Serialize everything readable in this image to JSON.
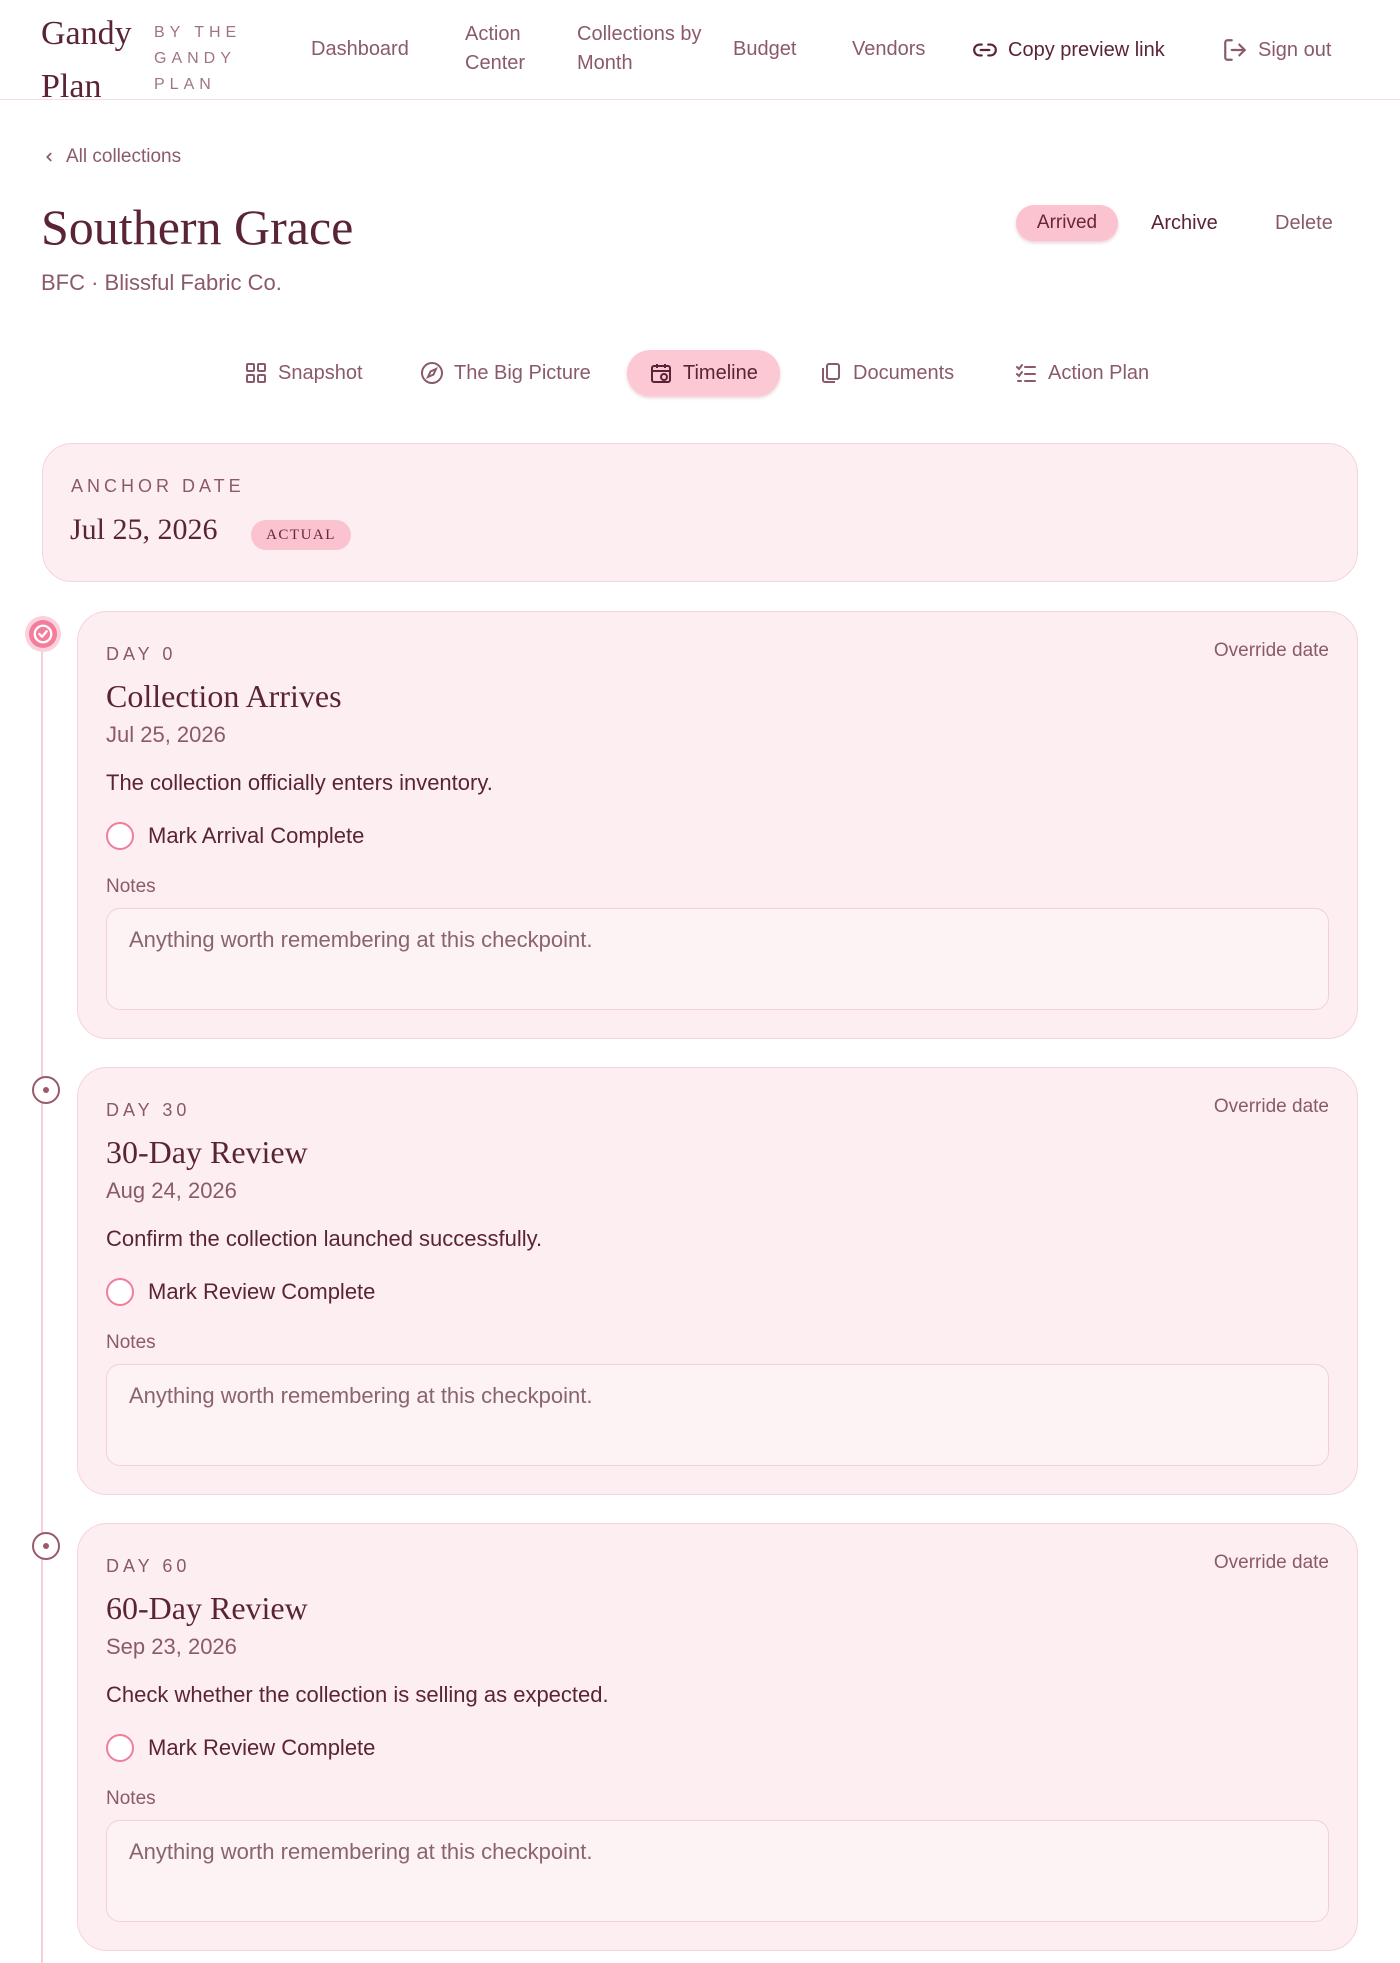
{
  "header": {
    "logo_line1": "Gandy",
    "logo_line2": "Plan",
    "logo_sub1": "BY THE",
    "logo_sub2": "GANDY",
    "logo_sub3": "PLAN",
    "nav": [
      {
        "label": "Dashboard"
      },
      {
        "label": "Action Center"
      },
      {
        "label": "Collections by Month"
      },
      {
        "label": "Budget"
      },
      {
        "label": "Vendors"
      }
    ],
    "copy_link": "Copy preview link",
    "sign_out": "Sign out"
  },
  "breadcrumb": "All collections",
  "collection": {
    "title": "Southern Grace",
    "subtitle": "BFC · Blissful Fabric Co.",
    "status": "Arrived",
    "archive": "Archive",
    "delete": "Delete"
  },
  "tabs": [
    {
      "label": "Snapshot",
      "icon": "grid-icon"
    },
    {
      "label": "The Big Picture",
      "icon": "compass-icon"
    },
    {
      "label": "Timeline",
      "icon": "calendar-icon",
      "active": true
    },
    {
      "label": "Documents",
      "icon": "documents-icon"
    },
    {
      "label": "Action Plan",
      "icon": "checklist-icon"
    }
  ],
  "anchor": {
    "label": "ANCHOR DATE",
    "date": "Jul 25, 2026",
    "badge": "ACTUAL"
  },
  "checkpoints": [
    {
      "day": "DAY 0",
      "title": "Collection Arrives",
      "date": "Jul 25, 2026",
      "description": "The collection officially enters inventory.",
      "toggle": "Mark Arrival Complete",
      "notes_label": "Notes",
      "notes_placeholder": "Anything worth remembering at this checkpoint.",
      "override": "Override date",
      "status": "done"
    },
    {
      "day": "DAY 30",
      "title": "30-Day Review",
      "date": "Aug 24, 2026",
      "description": "Confirm the collection launched successfully.",
      "toggle": "Mark Review Complete",
      "notes_label": "Notes",
      "notes_placeholder": "Anything worth remembering at this checkpoint.",
      "override": "Override date",
      "status": "pending"
    },
    {
      "day": "DAY 60",
      "title": "60-Day Review",
      "date": "Sep 23, 2026",
      "description": "Check whether the collection is selling as expected.",
      "toggle": "Mark Review Complete",
      "notes_label": "Notes",
      "notes_placeholder": "Anything worth remembering at this checkpoint.",
      "override": "Override date",
      "status": "pending"
    }
  ],
  "colors": {
    "accent": "#fcc8d4",
    "text": "#5a2436",
    "muted": "#8a5a6a",
    "card_bg": "#fdeff1",
    "done_node": "#f47d9c"
  }
}
